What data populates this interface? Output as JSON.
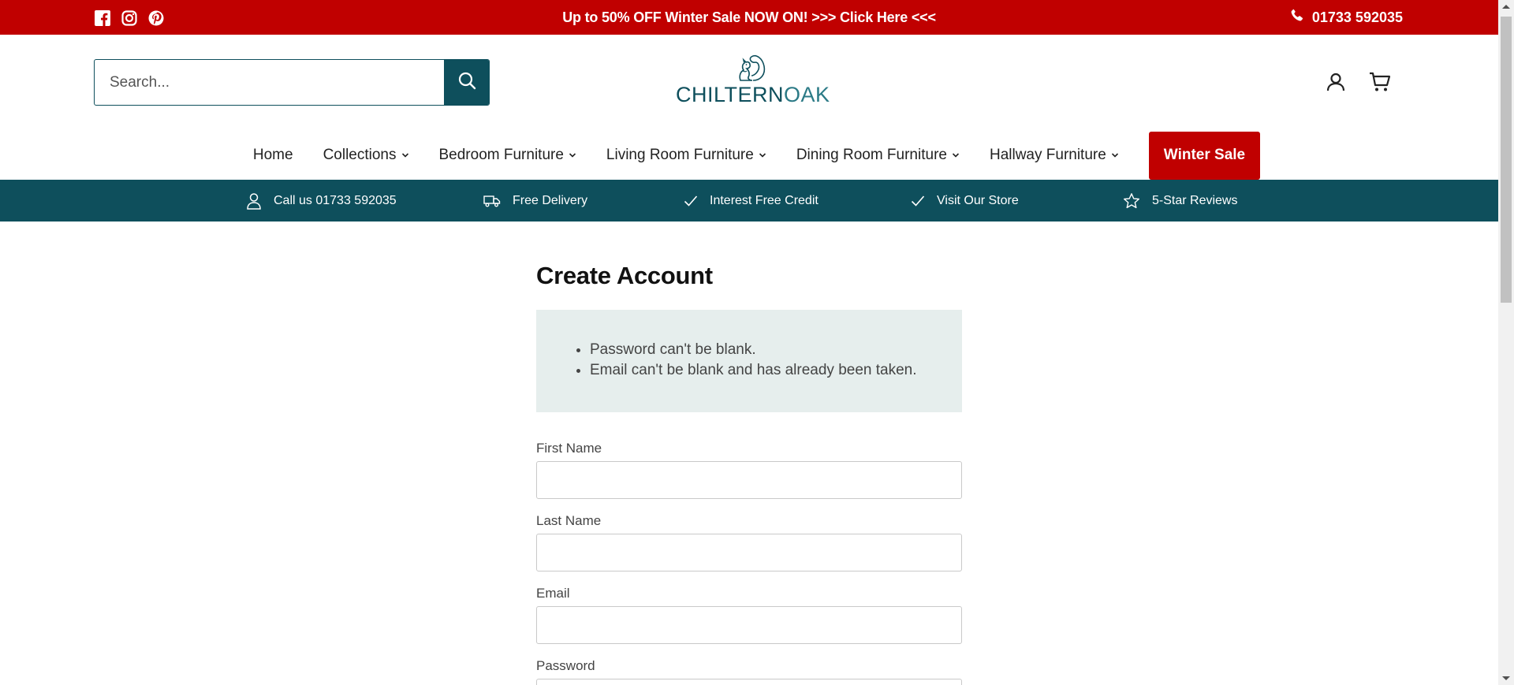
{
  "announcement": {
    "promo": "Up to 50% OFF Winter Sale NOW ON! >>> Click Here <<<",
    "phone": "01733 592035",
    "social_icons": [
      "facebook-icon",
      "instagram-icon",
      "pinterest-icon"
    ]
  },
  "header": {
    "search_placeholder": "Search...",
    "logo_text_primary": "CHILTERN",
    "logo_text_secondary": "OAK",
    "icons": [
      "account-icon",
      "cart-icon"
    ]
  },
  "nav": {
    "items": [
      {
        "label": "Home",
        "has_dropdown": false
      },
      {
        "label": "Collections",
        "has_dropdown": true
      },
      {
        "label": "Bedroom Furniture",
        "has_dropdown": true
      },
      {
        "label": "Living Room Furniture",
        "has_dropdown": true
      },
      {
        "label": "Dining Room Furniture",
        "has_dropdown": true
      },
      {
        "label": "Hallway Furniture",
        "has_dropdown": true
      }
    ],
    "sale_label": "Winter Sale"
  },
  "usp": {
    "items": [
      {
        "label": "Call us 01733 592035",
        "icon": "user-icon"
      },
      {
        "label": "Free Delivery",
        "icon": "truck-icon"
      },
      {
        "label": "Interest Free Credit",
        "icon": "check-icon"
      },
      {
        "label": "Visit Our Store",
        "icon": "check-icon"
      },
      {
        "label": "5-Star Reviews",
        "icon": "star-icon"
      }
    ]
  },
  "main": {
    "title": "Create Account",
    "errors": [
      "Password can't be blank.",
      "Email can't be blank and has already been taken."
    ],
    "fields": [
      {
        "label": "First Name",
        "value": ""
      },
      {
        "label": "Last Name",
        "value": ""
      },
      {
        "label": "Email",
        "value": ""
      },
      {
        "label": "Password",
        "value": ""
      }
    ]
  },
  "colors": {
    "brand_red": "#c00000",
    "brand_teal": "#0e4f5c",
    "error_bg": "#e6eeed"
  }
}
